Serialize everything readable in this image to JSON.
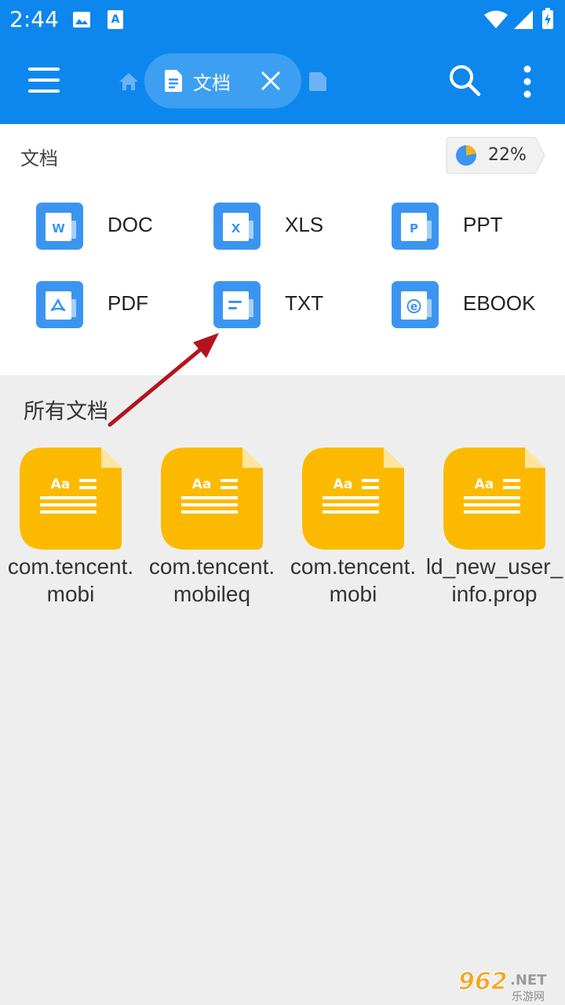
{
  "status_bar": {
    "time": "2:44",
    "icons": [
      "image-icon",
      "app-a-icon",
      "wifi-icon",
      "signal-icon",
      "battery-icon"
    ]
  },
  "toolbar": {
    "menu_icon": "hamburger-menu-icon",
    "home_icon": "home-icon",
    "active_tab": {
      "icon": "document-icon",
      "label": "文档",
      "close_icon": "close-icon"
    },
    "next_tab_icon": "document-icon",
    "search_icon": "search-icon",
    "more_icon": "more-vertical-icon"
  },
  "category_panel": {
    "title": "文档",
    "storage_percent": "22%",
    "storage_fraction": 0.22,
    "categories": [
      {
        "label": "DOC",
        "letter": "W",
        "icon": "word-doc-icon"
      },
      {
        "label": "XLS",
        "letter": "X",
        "icon": "excel-icon"
      },
      {
        "label": "PPT",
        "letter": "P",
        "icon": "powerpoint-icon"
      },
      {
        "label": "PDF",
        "letter": "",
        "icon": "pdf-icon"
      },
      {
        "label": "TXT",
        "letter": "",
        "icon": "text-file-icon"
      },
      {
        "label": "EBOOK",
        "letter": "e",
        "icon": "ebook-icon"
      }
    ]
  },
  "all_documents": {
    "title": "所有文档",
    "files": [
      {
        "name": "com.tencent.mobi",
        "icon_text": "Aa"
      },
      {
        "name": "com.tencent.mobileq",
        "icon_text": "Aa"
      },
      {
        "name": "com.tencent.mobi",
        "icon_text": "Aa"
      },
      {
        "name": "ld_new_user_info.prop",
        "icon_text": "Aa"
      }
    ]
  },
  "colors": {
    "app_bar": "#0d87ee",
    "category_icon": "#3b95f0",
    "file_icon": "#fbba00",
    "arrow": "#b4141e"
  },
  "watermark": {
    "main": "962",
    "suffix": ".NET",
    "sub": "乐游网"
  }
}
